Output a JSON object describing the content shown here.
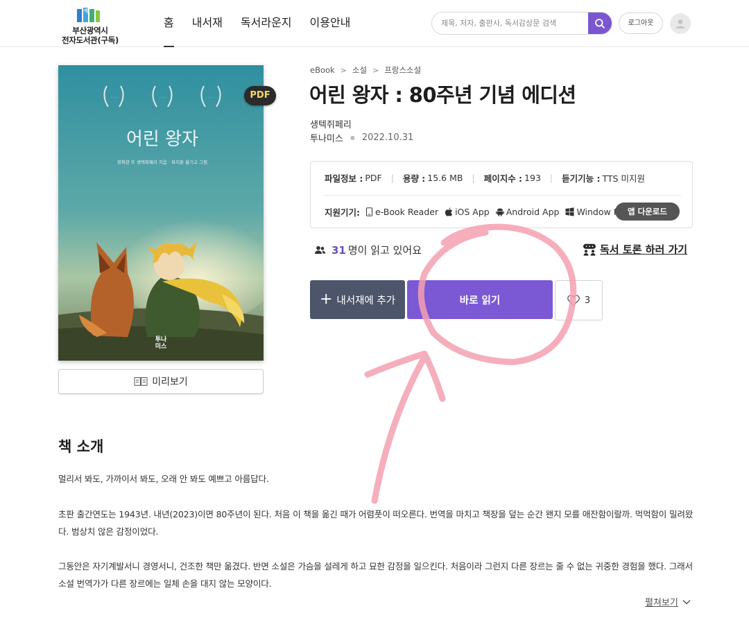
{
  "header": {
    "logo_line1": "부산광역시",
    "logo_line2": "전자도서관(구독)",
    "nav": [
      "홈",
      "내서재",
      "독서라운지",
      "이용안내"
    ],
    "search_placeholder": "제목, 저자, 출판사, 독서감상문 검색",
    "logout_label": "로그아웃"
  },
  "book": {
    "breadcrumb": [
      "eBook",
      "소설",
      "프랑스소설"
    ],
    "title": "어린 왕자 : 80주년 기념 에디션",
    "author": "생텍쥐페리",
    "publisher": "투나미스",
    "date": "2022.10.31",
    "format_badge": "PDF",
    "cover_title": "어린 왕자",
    "cover_credit": "정확관 또 생텍쥐페리 지음 · 파지훈 옮기고 그림",
    "cover_publisher_line1": "투나",
    "cover_publisher_line2": "미스",
    "preview_label": "미리보기"
  },
  "info": {
    "file_label": "파일정보 :",
    "file_value": "PDF",
    "size_label": "용량 :",
    "size_value": "15.6 MB",
    "pages_label": "페이지수 :",
    "pages_value": "193",
    "listen_label": "듣기기능 :",
    "listen_value": "TTS 미지원",
    "devices_label": "지원기기:",
    "devices": [
      "e-Book Reader",
      "iOS App",
      "Android App",
      "Window PC"
    ],
    "app_download": "앱 다운로드"
  },
  "readers": {
    "count": "31",
    "text": "명이 읽고 있어요"
  },
  "discussion_link": "독서 토론 하러 가기",
  "actions": {
    "add_library": "내서재에 추가",
    "read_now": "바로 읽기",
    "likes": "3"
  },
  "intro": {
    "title": "책 소개",
    "p1": "멀리서 봐도, 가까이서 봐도, 오래 안 봐도 예쁘고 아름답다.",
    "p2": "초판 출간연도는 1943년. 내년(2023)이면 80주년이 된다. 처음 이 책을 옮긴 때가 어렴풋이 떠오른다. 번역을 마치고 책장을 덮는 순간 왠지 모를 애잔함이랄까. 먹먹함이 밀려왔다. 범상치 않은 감정이었다.",
    "p3": "그동안은 자기계발서니 경영서니, 건조한 책만 옮겼다. 반면 소설은 가슴을 설레게 하고 묘한 감정을 일으킨다. 처음이라 그런지 다른 장르는 줄 수 없는 귀중한 경험을 했다. 그래서 소설 번역가가 다른 장르에는 일체 손을 대지 않는 모양이다.",
    "more_label": "펼쳐보기"
  },
  "colors": {
    "accent": "#7b59d4",
    "secondary_button": "#4d556a",
    "annotation": "#f4a0b0"
  }
}
